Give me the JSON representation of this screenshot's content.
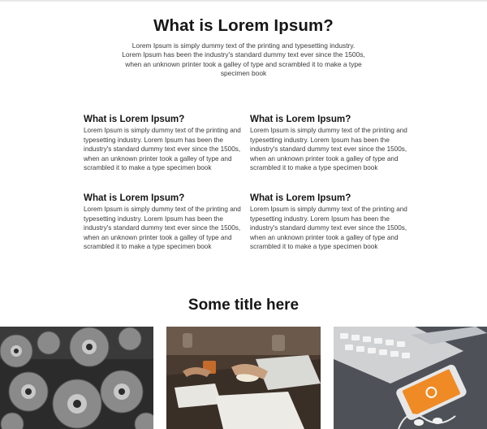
{
  "hero": {
    "title": "What is Lorem Ipsum?",
    "text": "Lorem Ipsum is simply dummy text of the printing and typesetting industry. Lorem Ipsum has been the industry's standard dummy text ever since the 1500s, when an unknown printer took a galley of type and scrambled it to make a type specimen book"
  },
  "features": [
    {
      "title": "What is Lorem Ipsum?",
      "text": "Lorem Ipsum is simply dummy text of the printing and typesetting industry. Lorem Ipsum has been the industry's standard dummy text ever since the 1500s, when an unknown printer took a galley of type and scrambled it to make a type specimen book"
    },
    {
      "title": "What is Lorem Ipsum?",
      "text": "Lorem Ipsum is simply dummy text of the printing and typesetting industry. Lorem Ipsum has been the industry's standard dummy text ever since the 1500s, when an unknown printer took a galley of type and scrambled it to make a type specimen book"
    },
    {
      "title": "What is Lorem Ipsum?",
      "text": "Lorem Ipsum is simply dummy text of the printing and typesetting industry. Lorem Ipsum has been the industry's standard dummy text ever since the 1500s, when an unknown printer took a galley of type and scrambled it to make a type specimen book"
    },
    {
      "title": "What is Lorem Ipsum?",
      "text": "Lorem Ipsum is simply dummy text of the printing and typesetting industry. Lorem Ipsum has been the industry's standard dummy text ever since the 1500s, when an unknown printer took a galley of type and scrambled it to make a type specimen book"
    }
  ],
  "gallery": {
    "title": "Some title here",
    "images": [
      {
        "subject": "gears-photo"
      },
      {
        "subject": "meeting-desk-photo"
      },
      {
        "subject": "keyboard-phone-photo"
      }
    ]
  }
}
